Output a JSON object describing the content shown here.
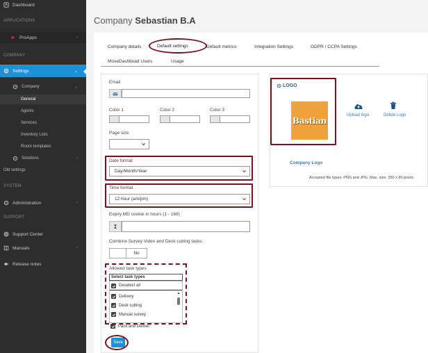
{
  "sidebar": {
    "dashboard": "Dashboard",
    "applications": "APPLICATIONS",
    "proapps": "ProApps",
    "company": "COMPANY",
    "settings": "Settings",
    "company_sub": "Company",
    "general": "General",
    "agents": "Agents",
    "services": "Services",
    "inventory_lists": "Inventory Lists",
    "room_templates": "Room templates",
    "solutions": "Solutions",
    "old_settings": "Old settings",
    "system": "SYSTEM",
    "administration": "Administration",
    "support": "SUPPORT",
    "support_center": "Support Center",
    "manuals": "Manuals",
    "release_notes": "Release notes"
  },
  "header": {
    "title_prefix": "Company",
    "title_name": "Sebastian B.A"
  },
  "tabs": [
    {
      "label": "Company details"
    },
    {
      "label": "Default settings"
    },
    {
      "label": "Default metrics"
    },
    {
      "label": "Integration Settings"
    },
    {
      "label": "GDPR / CCPA Settings"
    },
    {
      "label": "MoveDashboad Users"
    },
    {
      "label": "Usage"
    }
  ],
  "form": {
    "email_label": "Email",
    "email_value": "",
    "color1": "Color 1",
    "color2": "Color 2",
    "color3": "Color 3",
    "page_size_label": "Page size",
    "page_size_value": "",
    "date_format_label": "Date format",
    "date_format_value": "Day/Month/Year",
    "time_format_label": "Time format",
    "time_format_value": "12 hour (am/pm)",
    "expiry_label": "Expiry MD cookie in hours (1 - 168)",
    "expiry_value": "",
    "combine_label": "Combine Survey Video and Desk cubing tasks.",
    "combine_value": "No",
    "allowed_label": "Allowed task types",
    "allowed_placeholder": "Select task types",
    "deselect_all": "Deselect all",
    "options": [
      "Delivery",
      "Desk cubing",
      "Manual survey",
      "Pack and Deliver"
    ],
    "save_label": "Save"
  },
  "logo": {
    "header": "LOGO",
    "brand_text": "Bastian",
    "upload": "Upload logo",
    "delete": "Delete Logo",
    "company_logo": "Company Logo",
    "accepted": "Accepted file types: PNG and JPG. Max. size: 350 x 80 pixels"
  },
  "colors": {
    "accent": "#1e90d6",
    "annotation": "#7a1020",
    "sidebar_bg": "#2d2d2d"
  }
}
